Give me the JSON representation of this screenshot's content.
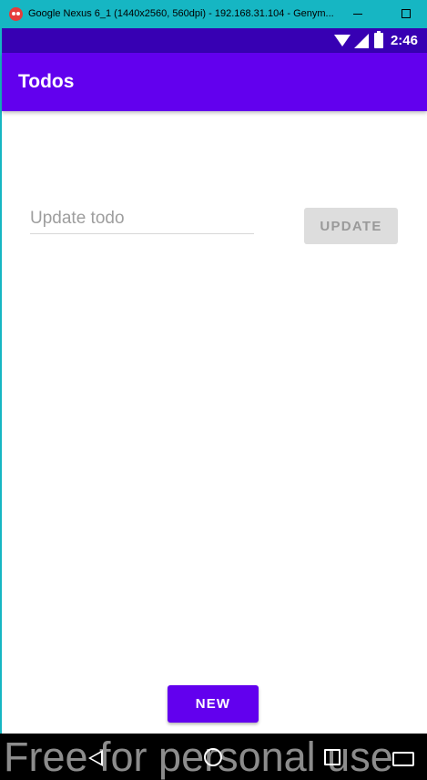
{
  "window": {
    "title": "Google Nexus 6_1 (1440x2560, 560dpi) - 192.168.31.104 - Genym..."
  },
  "status_bar": {
    "time": "2:46",
    "icons": [
      "wifi-icon",
      "signal-icon",
      "battery-icon"
    ]
  },
  "app_bar": {
    "title": "Todos",
    "color": "#6200ee"
  },
  "form": {
    "input_value": "",
    "input_placeholder": "Update todo",
    "update_label": "UPDATE"
  },
  "new_button": {
    "label": "NEW"
  },
  "nav_bar": {
    "icons": [
      "back-icon",
      "home-icon",
      "recents-icon",
      "keyboard-icon"
    ]
  },
  "watermark": "Free for personal use"
}
